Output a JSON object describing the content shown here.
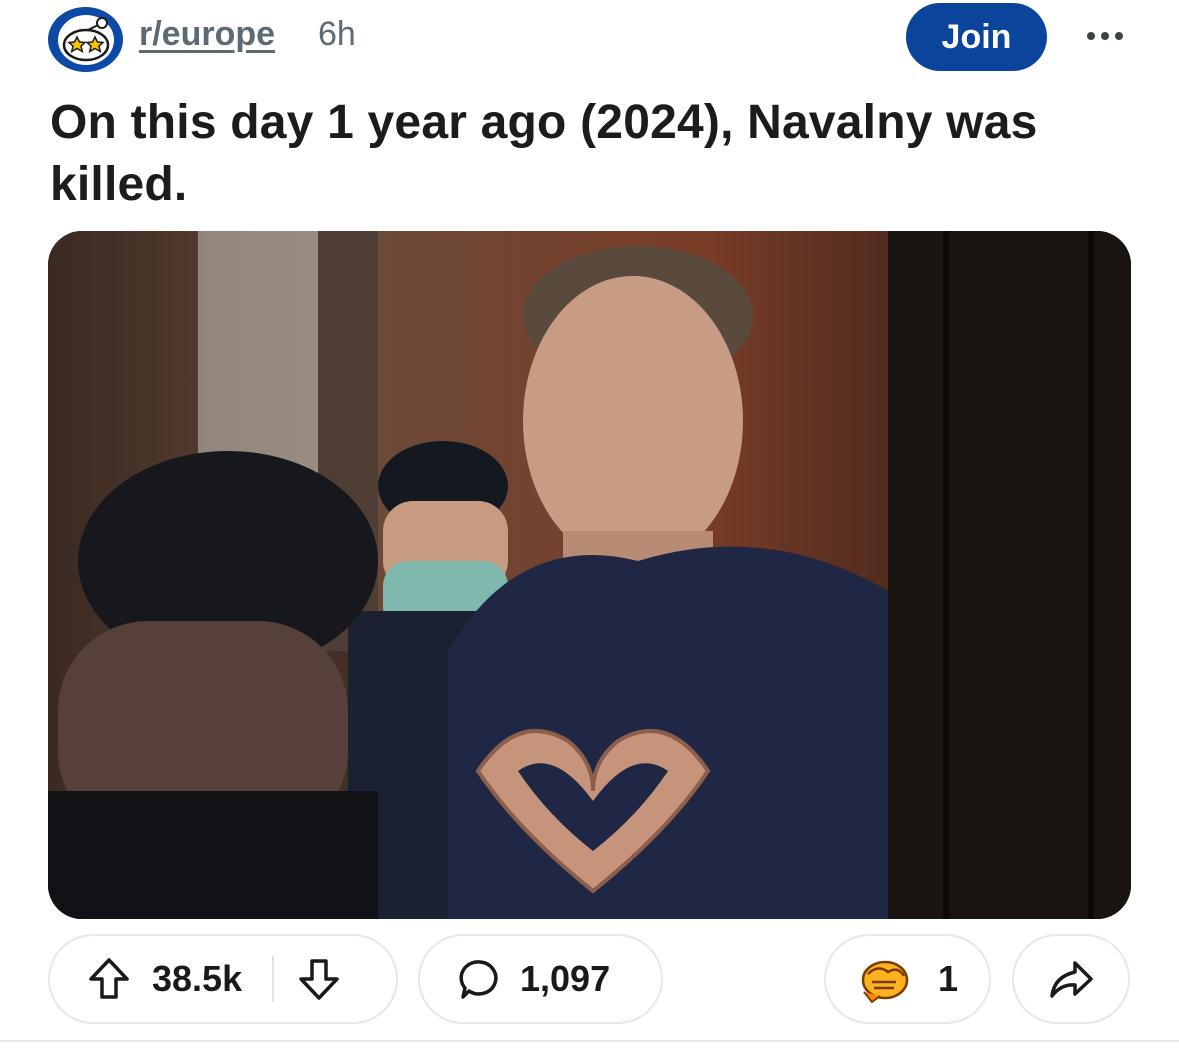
{
  "header": {
    "subreddit": "r/europe",
    "time_ago": "6h",
    "join_label": "Join"
  },
  "post": {
    "title": "On this day 1 year ago (2024), Navalny was killed."
  },
  "actions": {
    "upvotes": "38.5k",
    "comments": "1,097",
    "awards": "1"
  },
  "colors": {
    "join_bg": "#0a449b",
    "avatar_bg": "#0d4aa6",
    "meta_text": "#5c6a73",
    "pill_border": "#e6e8ea"
  },
  "icons": {
    "avatar": "subreddit-snoo-icon",
    "more": "more-options-icon",
    "upvote": "upvote-arrow-icon",
    "downvote": "downvote-arrow-icon",
    "comment": "comment-bubble-icon",
    "award": "handshake-award-icon",
    "share": "share-arrow-icon"
  }
}
